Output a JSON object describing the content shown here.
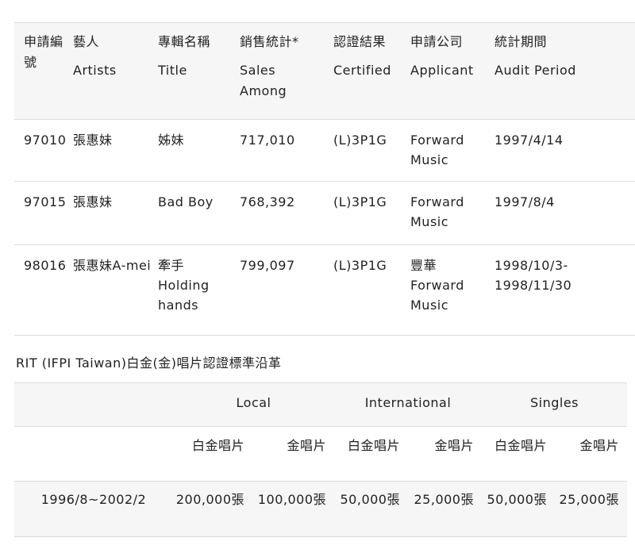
{
  "cert_table": {
    "headers": [
      {
        "zh": "申請編號",
        "en": ""
      },
      {
        "zh": "藝人",
        "en": "Artists"
      },
      {
        "zh": "專輯名稱",
        "en": "Title"
      },
      {
        "zh": "銷售統計*",
        "en": "Sales Among"
      },
      {
        "zh": "認證結果",
        "en": "Certified"
      },
      {
        "zh": "申請公司",
        "en": "Applicant"
      },
      {
        "zh": "統計期間",
        "en": "Audit Period"
      }
    ],
    "rows": [
      [
        "97010",
        "張惠妹",
        "姊妹",
        "717,010",
        "(L)3P1G",
        "Forward Music",
        "1997/4/14"
      ],
      [
        "97015",
        "張惠妹",
        "Bad Boy",
        "768,392",
        "(L)3P1G",
        "Forward Music",
        "1997/8/4"
      ],
      [
        "98016",
        "張惠妹A-mei",
        "牽手 Holding hands",
        "799,097",
        "(L)3P1G",
        "豐華 Forward Music",
        "1998/10/3-1998/11/30"
      ]
    ]
  },
  "section_title": "RIT (IFPI Taiwan)白金(金)唱片認證標準沿革",
  "std_table": {
    "groups": [
      "Local",
      "International",
      "Singles"
    ],
    "subheaders": [
      "白金唱片",
      "金唱片",
      "白金唱片",
      "金唱片",
      "白金唱片",
      "金唱片"
    ],
    "rows": [
      {
        "period": "1996/8~2002/2",
        "values": [
          "200,000張",
          "100,000張",
          "50,000張",
          "25,000張",
          "50,000張",
          "25,000張"
        ]
      }
    ]
  }
}
